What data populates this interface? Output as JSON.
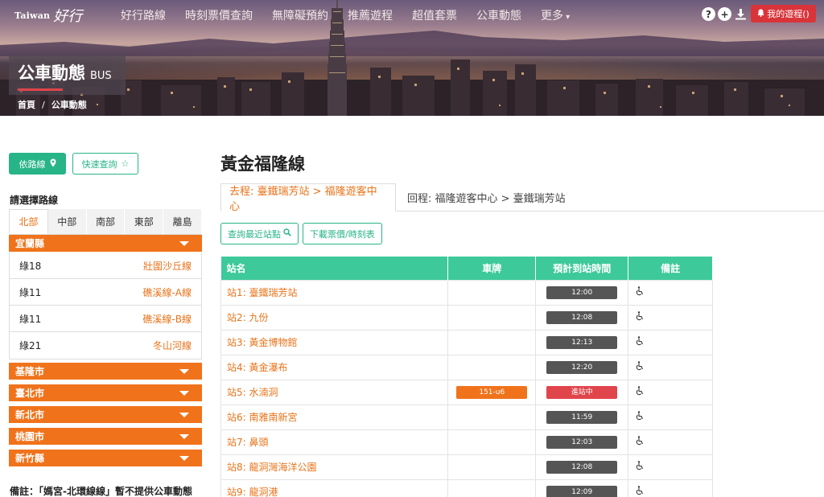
{
  "brand": {
    "taiwan": "Taiwan",
    "script": "好行"
  },
  "nav": [
    "好行路線",
    "時刻票價查詢",
    "無障礙預約",
    "推薦遊程",
    "超值套票",
    "公車動態",
    "更多"
  ],
  "nav_icons": [
    "help-icon",
    "plus-icon",
    "download-icon"
  ],
  "my_trip": "我的遊程()",
  "page_heading": {
    "zh": "公車動態",
    "en": "BUS"
  },
  "breadcrumb": [
    "首頁",
    "公車動態"
  ],
  "sidebar": {
    "route_btn": "依路線",
    "quick_btn": "快速查詢",
    "title": "請選擇路線",
    "regions": [
      "北部",
      "中部",
      "南部",
      "東部",
      "離島"
    ],
    "active_region": 0,
    "counties": [
      "宜蘭縣",
      "基隆市",
      "臺北市",
      "新北市",
      "桃園市",
      "新竹縣"
    ],
    "routes": [
      {
        "num": "綠18",
        "name": "壯圍沙丘線"
      },
      {
        "num": "綠11",
        "name": "礁溪線-A線"
      },
      {
        "num": "綠11",
        "name": "礁溪線-B線"
      },
      {
        "num": "綠21",
        "name": "冬山河線"
      }
    ],
    "note": "備註：「媽宮-北環線線」暫不提供公車動態"
  },
  "main": {
    "route_title": "黃金福隆線",
    "tab_outbound": "去程: 臺鐵瑞芳站 > 福隆遊客中心",
    "tab_return": "回程: 福隆遊客中心 > 臺鐵瑞芳站",
    "btn_nearby": "查詢最近站點",
    "btn_download": "下載票價/時刻表",
    "columns": [
      "站名",
      "車牌",
      "預計到站時間",
      "備註"
    ],
    "stops": [
      {
        "name": "站1: 臺鐵瑞芳站",
        "plate": "",
        "eta": "12:00",
        "arriving": false
      },
      {
        "name": "站2: 九份",
        "plate": "",
        "eta": "12:08",
        "arriving": false
      },
      {
        "name": "站3: 黃金博物館",
        "plate": "",
        "eta": "12:13",
        "arriving": false
      },
      {
        "name": "站4: 黃金瀑布",
        "plate": "",
        "eta": "12:20",
        "arriving": false
      },
      {
        "name": "站5: 水湳洞",
        "plate": "151-u6",
        "eta": "進站中",
        "arriving": true
      },
      {
        "name": "站6: 南雅南新宮",
        "plate": "",
        "eta": "11:59",
        "arriving": false
      },
      {
        "name": "站7: 鼻頭",
        "plate": "",
        "eta": "12:03",
        "arriving": false
      },
      {
        "name": "站8: 龍洞灣海洋公園",
        "plate": "",
        "eta": "12:08",
        "arriving": false
      },
      {
        "name": "站9: 龍洞港",
        "plate": "",
        "eta": "12:09",
        "arriving": false
      }
    ]
  },
  "colors": {
    "accent_orange": "#f0731c",
    "green": "#27b487",
    "table_header": "#3ec99b",
    "red": "#e0454b"
  }
}
